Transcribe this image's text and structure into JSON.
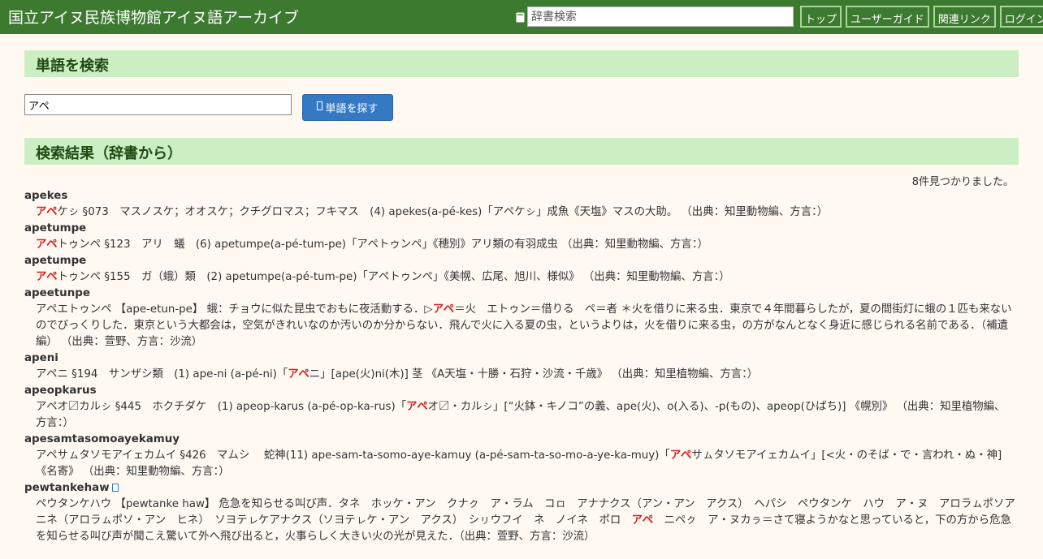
{
  "header": {
    "site_title": "国立アイヌ民族博物館アイヌ語アーカイブ",
    "search_placeholder": "辞書検索",
    "nav": [
      "トップ",
      "ユーザーガイド",
      "関連リンク",
      "ログイン"
    ]
  },
  "search_section": {
    "title": "単語を検索",
    "input_value": "アペ",
    "button_label": "単語を探す"
  },
  "results_section": {
    "title": "検索結果（辞書から）",
    "count_text": "8件見つかりました。",
    "entries": [
      {
        "word": "apekes",
        "pre": "",
        "hl": "アペ",
        "post": "ケㇱ §073　マスノスケ；オオスケ；クチグロマス；フキマス　(4) apekes(a-pé-kes)「アペケㇱ」成魚《天塩》マスの大助。 （出典：知里動物編、方言：）"
      },
      {
        "word": "apetumpe",
        "pre": "",
        "hl": "アペ",
        "post": "トゥンペ §123　アリ　蟻　(6) apetumpe(a-pé-tum-pe)「アペトゥンペ」《穂別》アリ類の有羽成虫 （出典：知里動物編、方言：）"
      },
      {
        "word": "apetumpe",
        "pre": "",
        "hl": "アペ",
        "post": "トゥンペ §155　ガ（蛾）類　(2) apetumpe(a-pé-tum-pe)「アペトゥンペ」《美幌、広尾、旭川、様似》 （出典：知里動物編、方言：）"
      },
      {
        "word": "apeetunpe",
        "pre": "アペエトゥンペ 【ape-etun-pe】 蛾：チョウに似た昆虫でおもに夜活動する．▷",
        "hl": "アペ",
        "post": "＝火　エトゥン＝借りる　ペ＝者 ＊火を借りに来る虫．東京で４年間暮らしたが，夏の間街灯に蛾の１匹も来ないのでびっくりした．東京という大都会は，空気がきれいなのか汚いのか分からない．飛んで火に入る夏の虫，というよりは，火を借りに来る虫，の方がなんとなく身近に感じられる名前である．（補遺編） （出典：萱野、方言：沙流）"
      },
      {
        "word": "apeni",
        "pre": "アペニ §194　サンザシ類　(1) ape-ni (a-pé-ni)「",
        "hl": "アペ",
        "post": "ニ」[ape(火)ni(木)] 茎 《A天塩・十勝・石狩・沙流・千歳》 （出典：知里植物編、方言：）"
      },
      {
        "word": "apeopkarus",
        "pre": "アペオ〼カルㇱ §445　ホクチダケ　(1) apeop-karus (a-pé-op-ka-rus)「",
        "hl": "アペ",
        "post": "オ〼・カルㇱ」[“火鉢・キノコ”の義、ape(火)、o(入る)、-p(もの)、apeop(ひばち)] 《幌別》 （出典：知里植物編、方言：）"
      },
      {
        "word": "apesamtasomoayekamuy",
        "pre": "アペサㇺタソモアイェカムイ §426　マムシ　 蛇神(11) ape-sam-ta-somo-aye-kamuy (a-pé-sam-ta-so-mo-a-ye-ka-muy)「",
        "hl": "アペ",
        "post": "サㇺタソモアイェカムイ」[<火・のそば・で・言われ・ぬ・神] 《名寄》 （出典：知里動物編、方言：）"
      },
      {
        "word": "pewtankehaw",
        "pre": "ペウタンケハウ 【pewtanke haw】 危急を知らせる叫び声．タネ　ホッケ・アン　クナㇰ　ア・ラム　コㇿ　アナナクス（アン・アン　アクス）　ヘパシ　ペウタンケ　ハウ　ア・ヌ　アロラㇺポソアニネ（アロラㇺポソ・アン　ヒネ）　ソヨテㇾケアナクス（ソヨテㇾケ・アン　アクス）　シㇼウフイ　ネ　ノイネ　ポロ　",
        "hl": "アペ",
        "post": "　ニペㇰ　ア・ヌカㇻ＝さて寝ようかなと思っていると，下の方から危急を知らせる叫び声が聞こえ驚いて外へ飛び出ると，火事らしく大きい火の光が見えた．（出典：萱野、方言：沙流）"
      }
    ]
  },
  "colors": {
    "header_bg": "#3c7a2f",
    "section_bg": "#cbeec2",
    "page_bg": "#fff9f2",
    "highlight": "#d42020",
    "button_bg": "#3579c4"
  },
  "icons": {
    "dictionary": "book-icon",
    "search_button": "search-icon",
    "external": "external-link-icon"
  }
}
